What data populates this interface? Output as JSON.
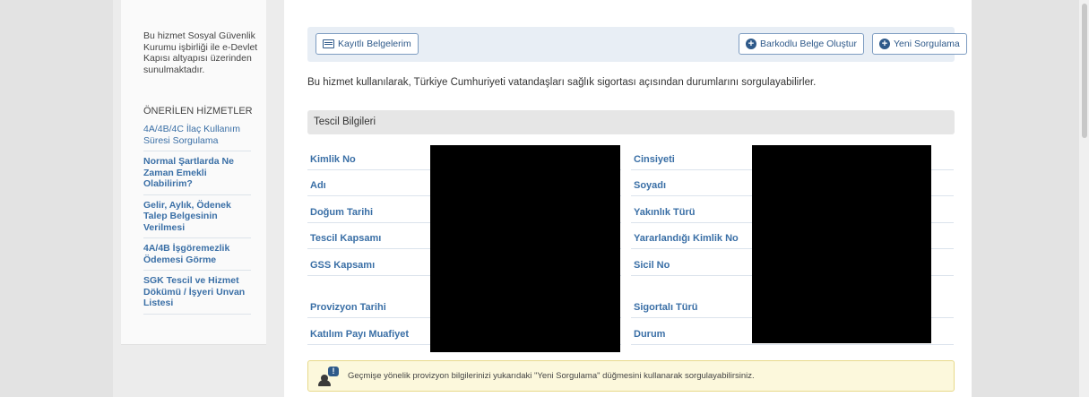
{
  "sidebar": {
    "note": "Bu hizmet Sosyal Güvenlik Kurumu işbirliği ile e-Devlet Kapısı altyapısı üzerinden sunulmaktadır.",
    "heading": "ÖNERİLEN HİZMETLER",
    "items": [
      {
        "label": "4A/4B/4C İlaç Kullanım Süresi Sorgulama"
      },
      {
        "label": "Normal Şartlarda Ne Zaman Emekli Olabilirim?"
      },
      {
        "label": "Gelir, Aylık, Ödenek Talep Belgesinin Verilmesi"
      },
      {
        "label": "4A/4B İşgöremezlik Ödemesi Görme"
      },
      {
        "label": "SGK Tescil ve Hizmet Dökümü / İşyeri Unvan Listesi"
      }
    ]
  },
  "toolbar": {
    "records_label": "Kayıtlı Belgelerim",
    "barcode_label": "Barkodlu Belge Oluştur",
    "new_query_label": "Yeni Sorgulama"
  },
  "intro": "Bu hizmet kullanılarak, Türkiye Cumhuriyeti vatandaşları sağlık sigortası açısından durumlarını sorgulayabilirler.",
  "section": {
    "title": "Tescil Bilgileri",
    "left_fields": [
      "Kimlik No",
      "Adı",
      "Doğum Tarihi",
      "Tescil Kapsamı",
      "GSS Kapsamı",
      "Provizyon Tarihi",
      "Katılım Payı Muafiyet"
    ],
    "right_fields": [
      "Cinsiyeti",
      "Soyadı",
      "Yakınlık Türü",
      "Yararlandığı Kimlik No",
      "Sicil No",
      "Sigortalı Türü",
      "Durum"
    ]
  },
  "notice": "Geçmişe yönelik provizyon bilgilerinizi yukarıdaki \"Yeni Sorgulama\" düğmesini kullanarak sorgulayabilirsiniz.",
  "icons": {
    "records": "list-icon",
    "barcode": "plus-circle-icon",
    "new_query": "plus-circle-icon",
    "notice": "user-alert-icon"
  },
  "colors": {
    "link": "#3a6fa6",
    "button_text": "#2f5a8a",
    "notice_bg": "#fcf8dc",
    "redaction": "#000000"
  }
}
